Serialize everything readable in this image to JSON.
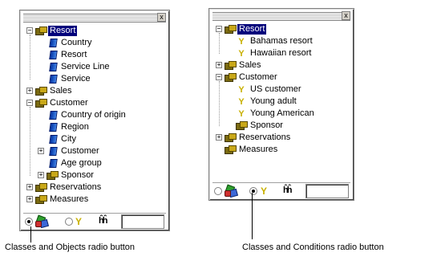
{
  "left_panel": {
    "tree": [
      {
        "label": "Resort",
        "kind": "class",
        "level": 0,
        "expander": "−",
        "selected": true
      },
      {
        "label": "Country",
        "kind": "object",
        "level": 1
      },
      {
        "label": "Resort",
        "kind": "object",
        "level": 1
      },
      {
        "label": "Service Line",
        "kind": "object",
        "level": 1
      },
      {
        "label": "Service",
        "kind": "object",
        "level": 1
      },
      {
        "label": "Sales",
        "kind": "class",
        "level": 0,
        "expander": "+"
      },
      {
        "label": "Customer",
        "kind": "class",
        "level": 0,
        "expander": "−"
      },
      {
        "label": "Country of origin",
        "kind": "object",
        "level": 1
      },
      {
        "label": "Region",
        "kind": "object",
        "level": 1
      },
      {
        "label": "City",
        "kind": "object",
        "level": 1
      },
      {
        "label": "Customer",
        "kind": "object",
        "level": 1,
        "expander": "+"
      },
      {
        "label": "Age group",
        "kind": "object",
        "level": 1
      },
      {
        "label": "Sponsor",
        "kind": "class",
        "level": 1,
        "expander": "+"
      },
      {
        "label": "Reservations",
        "kind": "class",
        "level": 0,
        "expander": "+"
      },
      {
        "label": "Measures",
        "kind": "class",
        "level": 0,
        "expander": "+"
      }
    ],
    "bottom": {
      "mode": "classes-objects"
    }
  },
  "right_panel": {
    "tree": [
      {
        "label": "Resort",
        "kind": "class",
        "level": 0,
        "expander": "−",
        "selected": true
      },
      {
        "label": "Bahamas resort",
        "kind": "condition",
        "level": 1
      },
      {
        "label": "Hawaiian resort",
        "kind": "condition",
        "level": 1
      },
      {
        "label": "Sales",
        "kind": "class",
        "level": 0,
        "expander": "+"
      },
      {
        "label": "Customer",
        "kind": "class",
        "level": 0,
        "expander": "−"
      },
      {
        "label": "US customer",
        "kind": "condition",
        "level": 1
      },
      {
        "label": "Young adult",
        "kind": "condition",
        "level": 1
      },
      {
        "label": "Young American",
        "kind": "condition",
        "level": 1
      },
      {
        "label": "Sponsor",
        "kind": "class",
        "level": 1
      },
      {
        "label": "Reservations",
        "kind": "class",
        "level": 0,
        "expander": "+"
      },
      {
        "label": "Measures",
        "kind": "class",
        "level": 0
      }
    ],
    "bottom": {
      "mode": "classes-conditions"
    }
  },
  "captions": {
    "left": "Classes and Objects radio button",
    "right": "Classes and Conditions radio button"
  },
  "close_glyph": "x",
  "icons": {
    "class": "class-folder-icon",
    "object": "object-icon",
    "condition": "filter-icon",
    "find": "binoculars-icon"
  }
}
